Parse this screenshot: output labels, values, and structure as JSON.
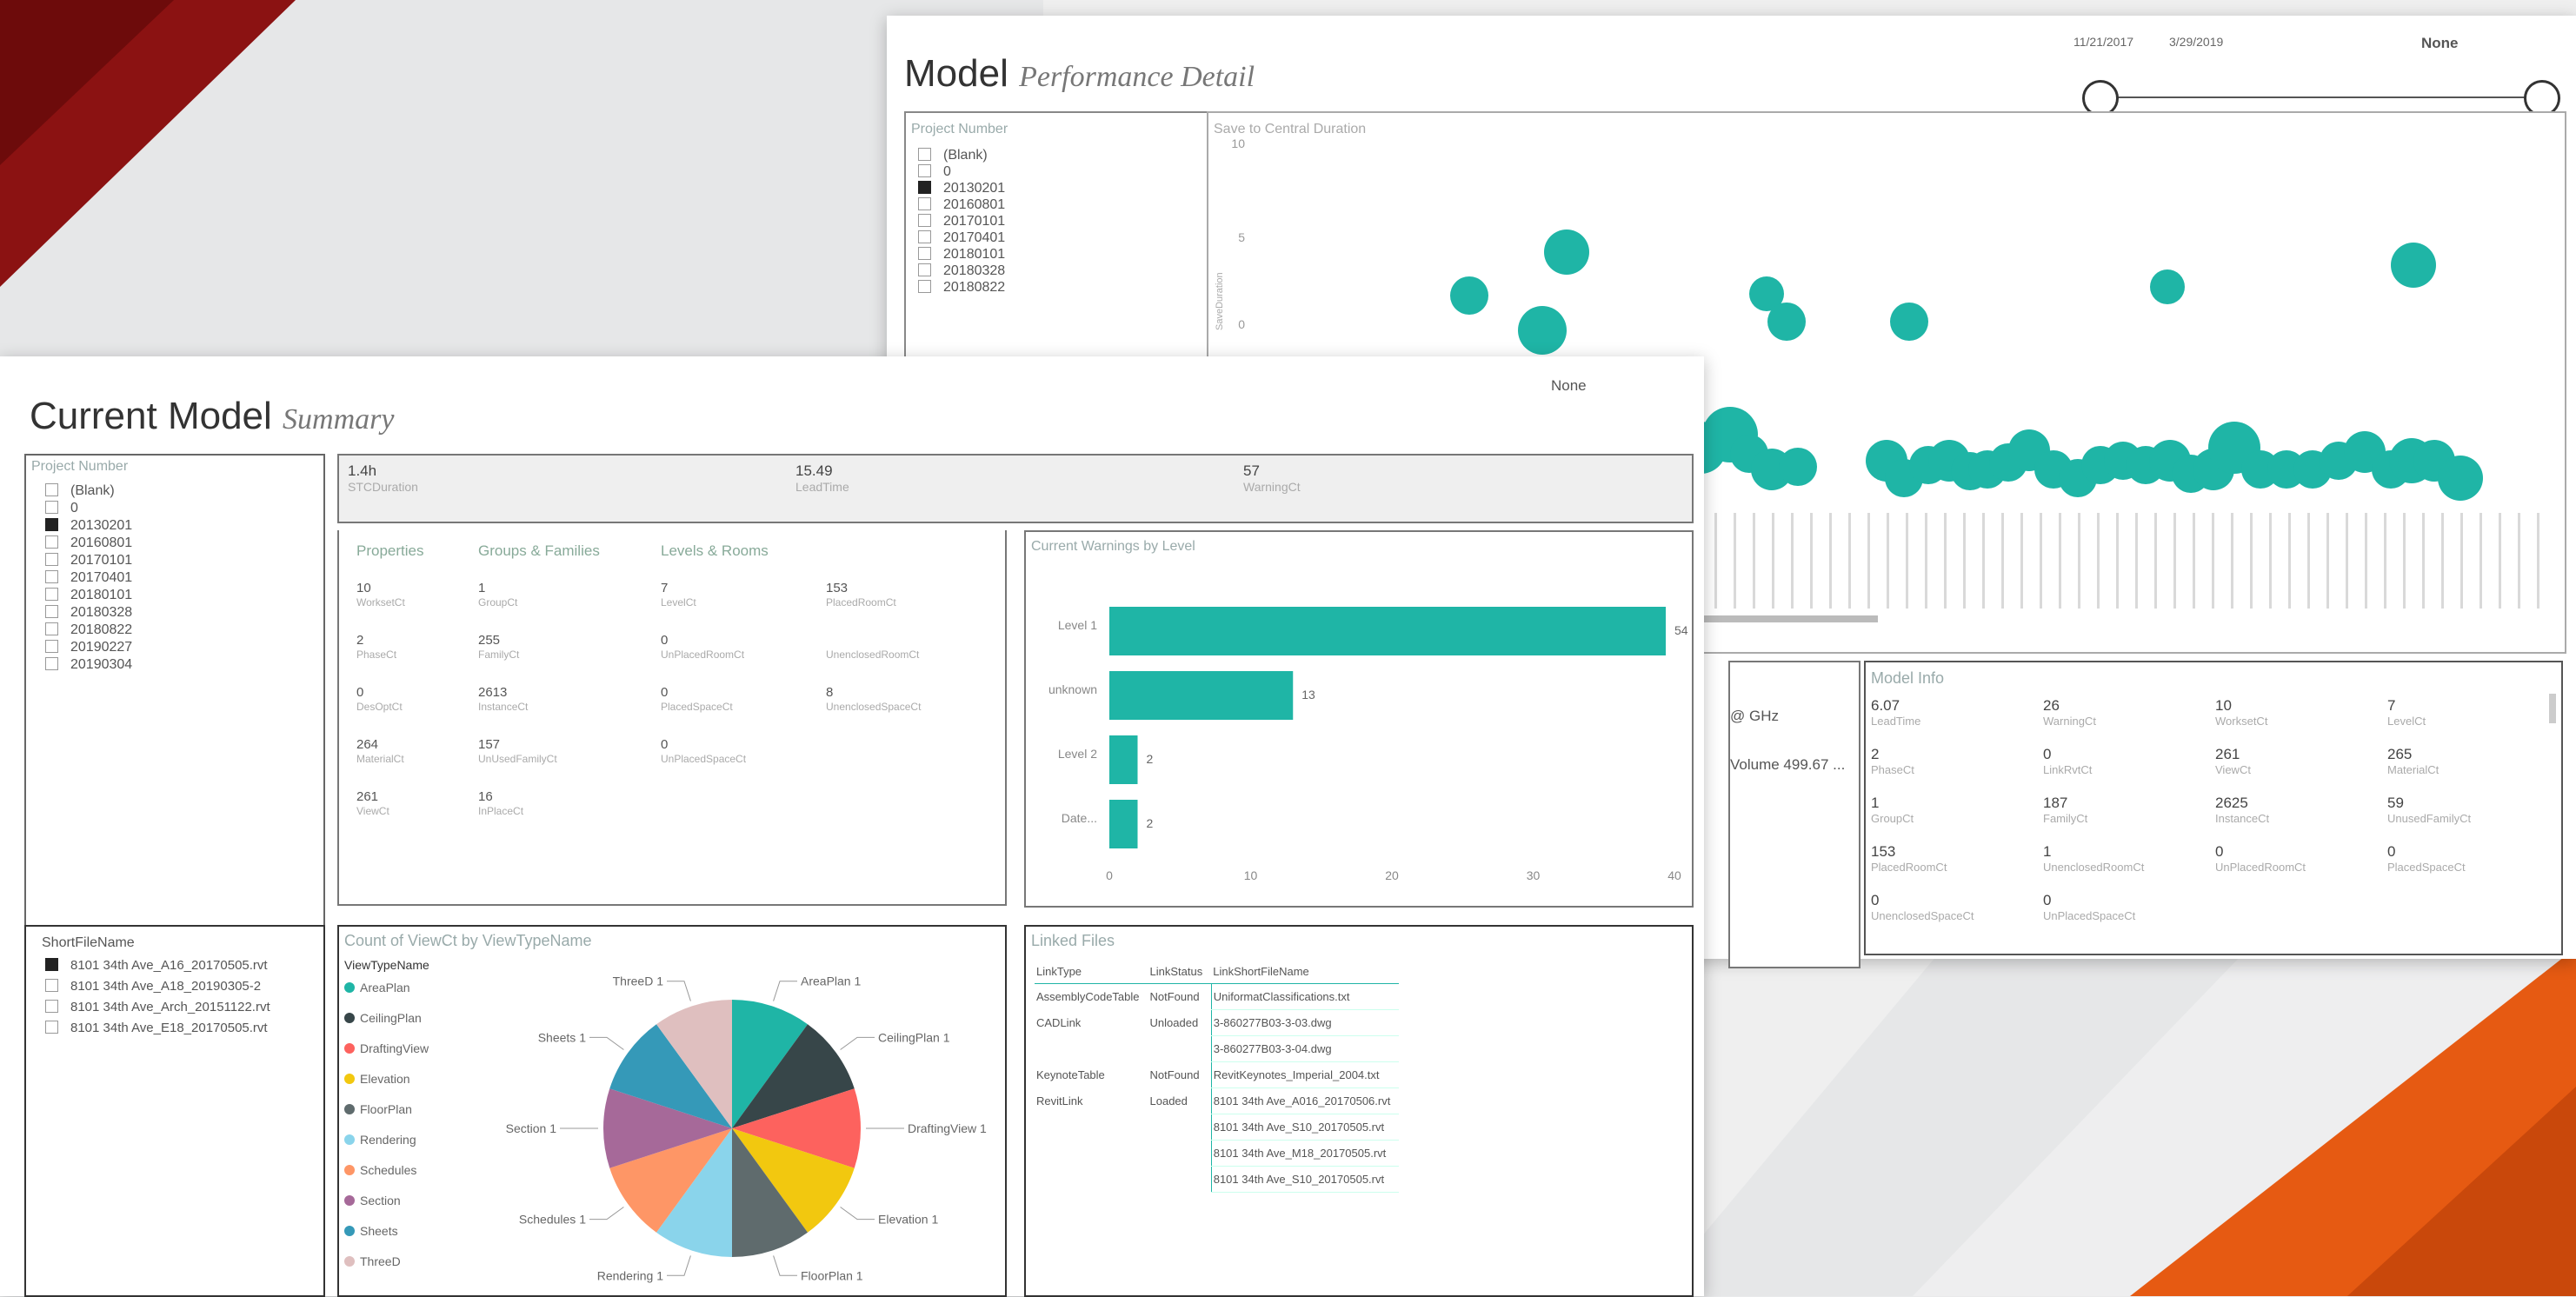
{
  "colors": {
    "teal": "#1fb5a6",
    "red": "#8b1212",
    "orange": "#e65a12"
  },
  "back_panel": {
    "title": "Model",
    "subtitle": "Performance Detail",
    "date_start": "11/21/2017",
    "date_end": "3/29/2019",
    "none_label": "None",
    "project_slicer": {
      "label": "Project Number",
      "items": [
        {
          "label": "(Blank)",
          "checked": false
        },
        {
          "label": "0",
          "checked": false
        },
        {
          "label": "20130201",
          "checked": true
        },
        {
          "label": "20160801",
          "checked": false
        },
        {
          "label": "20170101",
          "checked": false
        },
        {
          "label": "20170401",
          "checked": false
        },
        {
          "label": "20180101",
          "checked": false
        },
        {
          "label": "20180328",
          "checked": false
        },
        {
          "label": "20180822",
          "checked": false
        }
      ]
    },
    "scatter": {
      "title": "Save to Central Duration",
      "y_ticks": [
        "10",
        "5",
        "0"
      ],
      "y_label": "SaveDuration"
    },
    "hardware_card": {
      "ghz": "@ GHz",
      "volume": "Volume 499.67 ..."
    },
    "model_info": {
      "title": "Model Info",
      "cells": [
        {
          "value": "6.07",
          "label": "LeadTime"
        },
        {
          "value": "26",
          "label": "WarningCt"
        },
        {
          "value": "10",
          "label": "WorksetCt"
        },
        {
          "value": "7",
          "label": "LevelCt"
        },
        {
          "value": "2",
          "label": "PhaseCt"
        },
        {
          "value": "0",
          "label": "LinkRvtCt"
        },
        {
          "value": "261",
          "label": "ViewCt"
        },
        {
          "value": "265",
          "label": "MaterialCt"
        },
        {
          "value": "1",
          "label": "GroupCt"
        },
        {
          "value": "187",
          "label": "FamilyCt"
        },
        {
          "value": "2625",
          "label": "InstanceCt"
        },
        {
          "value": "59",
          "label": "UnusedFamilyCt"
        },
        {
          "value": "153",
          "label": "PlacedRoomCt"
        },
        {
          "value": "1",
          "label": "UnenclosedRoomCt"
        },
        {
          "value": "0",
          "label": "UnPlacedRoomCt"
        },
        {
          "value": "0",
          "label": "PlacedSpaceCt"
        },
        {
          "value": "0",
          "label": "UnenclosedSpaceCt"
        },
        {
          "value": "0",
          "label": "UnPlacedSpaceCt"
        }
      ]
    }
  },
  "front_panel": {
    "title": "Current Model",
    "subtitle": "Summary",
    "none_label": "None",
    "project_slicer": {
      "label": "Project Number",
      "items": [
        {
          "label": "(Blank)",
          "checked": false
        },
        {
          "label": "0",
          "checked": false
        },
        {
          "label": "20130201",
          "checked": true
        },
        {
          "label": "20160801",
          "checked": false
        },
        {
          "label": "20170101",
          "checked": false
        },
        {
          "label": "20170401",
          "checked": false
        },
        {
          "label": "20180101",
          "checked": false
        },
        {
          "label": "20180328",
          "checked": false
        },
        {
          "label": "20180822",
          "checked": false
        },
        {
          "label": "20190227",
          "checked": false
        },
        {
          "label": "20190304",
          "checked": false
        }
      ]
    },
    "kpis": [
      {
        "value": "1.4h",
        "label": "STCDuration"
      },
      {
        "value": "15.49",
        "label": "LeadTime"
      },
      {
        "value": "57",
        "label": "WarningCt"
      }
    ],
    "stats": {
      "headers": [
        "Properties",
        "Groups & Families",
        "Levels & Rooms"
      ],
      "rows": [
        [
          {
            "v": "10",
            "l": "WorksetCt"
          },
          {
            "v": "1",
            "l": "GroupCt"
          },
          {
            "v": "7",
            "l": "LevelCt"
          },
          {
            "v": "153",
            "l": "PlacedRoomCt"
          }
        ],
        [
          {
            "v": "2",
            "l": "PhaseCt"
          },
          {
            "v": "255",
            "l": "FamilyCt"
          },
          {
            "v": "0",
            "l": "UnPlacedRoomCt"
          },
          {
            "v": "",
            "l": "UnenclosedRoomCt"
          }
        ],
        [
          {
            "v": "0",
            "l": "DesOptCt"
          },
          {
            "v": "2613",
            "l": "InstanceCt"
          },
          {
            "v": "0",
            "l": "PlacedSpaceCt"
          },
          {
            "v": "8",
            "l": "UnenclosedSpaceCt"
          }
        ],
        [
          {
            "v": "264",
            "l": "MaterialCt"
          },
          {
            "v": "157",
            "l": "UnUsedFamilyCt"
          },
          {
            "v": "0",
            "l": "UnPlacedSpaceCt"
          },
          {
            "v": "",
            "l": ""
          }
        ],
        [
          {
            "v": "261",
            "l": "ViewCt"
          },
          {
            "v": "16",
            "l": "InPlaceCt"
          },
          {
            "v": "",
            "l": ""
          },
          {
            "v": "",
            "l": ""
          }
        ]
      ]
    },
    "warnings_chart": {
      "title": "Current Warnings by Level",
      "categories": [
        "Level 1",
        "unknown",
        "Level 2",
        "Date..."
      ],
      "values": [
        54,
        13,
        2,
        2
      ],
      "x_ticks": [
        "0",
        "10",
        "20",
        "30",
        "40"
      ]
    },
    "shortfile_slicer": {
      "label": "ShortFileName",
      "items": [
        {
          "label": "8101 34th Ave_A16_20170505.rvt",
          "checked": true
        },
        {
          "label": "8101 34th Ave_A18_20190305-2",
          "checked": false
        },
        {
          "label": "8101 34th Ave_Arch_20151122.rvt",
          "checked": false
        },
        {
          "label": "8101 34th Ave_E18_20170505.rvt",
          "checked": false
        }
      ]
    },
    "pie_chart": {
      "title": "Count of ViewCt by ViewTypeName",
      "legend_title": "ViewTypeName",
      "slices": [
        {
          "name": "AreaPlan",
          "value": 1,
          "color": "#1fb5a6"
        },
        {
          "name": "CeilingPlan",
          "value": 1,
          "color": "#374649"
        },
        {
          "name": "DraftingView",
          "value": 1,
          "color": "#fd625e"
        },
        {
          "name": "Elevation",
          "value": 1,
          "color": "#f2c80f"
        },
        {
          "name": "FloorPlan",
          "value": 1,
          "color": "#5f6b6d"
        },
        {
          "name": "Rendering",
          "value": 1,
          "color": "#8ad4eb"
        },
        {
          "name": "Schedules",
          "value": 1,
          "color": "#fe9666"
        },
        {
          "name": "Section",
          "value": 1,
          "color": "#a66999"
        },
        {
          "name": "Sheets",
          "value": 1,
          "color": "#3599b8"
        },
        {
          "name": "ThreeD",
          "value": 1,
          "color": "#dfbfbf"
        }
      ],
      "callouts": [
        "AreaPlan 1",
        "CeilingPlan 1",
        "DraftingView 1",
        "Elevation 1",
        "FloorPlan 1",
        "Rendering 1",
        "Schedules 1",
        "Section 1",
        "Sheets 1",
        "ThreeD 1"
      ]
    },
    "linked_files": {
      "title": "Linked Files",
      "columns": [
        "LinkType",
        "LinkStatus",
        "LinkShortFileName"
      ],
      "rows": [
        [
          "AssemblyCodeTable",
          "NotFound",
          "UniformatClassifications.txt"
        ],
        [
          "CADLink",
          "Unloaded",
          "3-860277B03-3-03.dwg"
        ],
        [
          "",
          "",
          "3-860277B03-3-04.dwg"
        ],
        [
          "KeynoteTable",
          "NotFound",
          "RevitKeynotes_Imperial_2004.txt"
        ],
        [
          "RevitLink",
          "Loaded",
          "8101 34th Ave_A016_20170506.rvt"
        ],
        [
          "",
          "",
          "8101 34th Ave_S10_20170505.rvt"
        ],
        [
          "",
          "",
          "8101 34th Ave_M18_20170505.rvt"
        ],
        [
          "",
          "",
          "8101 34th Ave_S10_20170505.rvt"
        ]
      ]
    }
  }
}
